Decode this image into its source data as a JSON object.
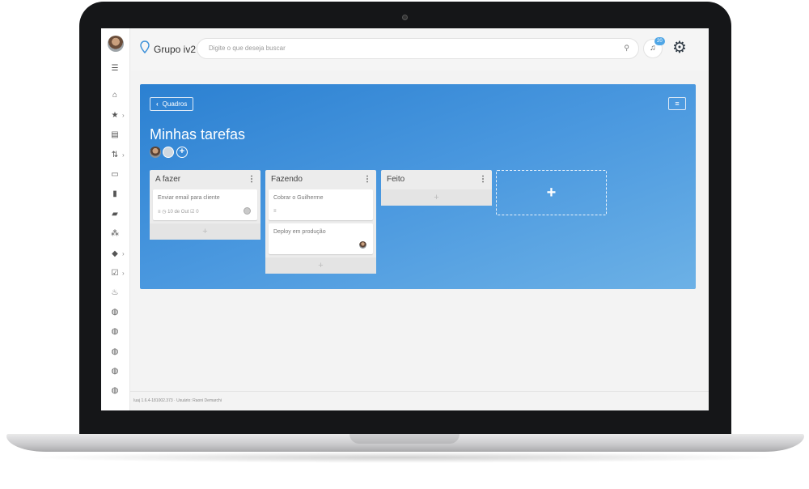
{
  "app": {
    "brand": "Grupo iv2"
  },
  "search": {
    "placeholder": "Digite o que deseja buscar"
  },
  "notifications": {
    "badge": "20"
  },
  "sidebar": {
    "icons": [
      "menu-icon",
      "home-icon",
      "star-icon",
      "book-icon",
      "swap-icon",
      "monitor-icon",
      "trash-icon",
      "chat-icon",
      "people-icon",
      "school-icon",
      "clipboard-check-icon",
      "fire-icon",
      "globe-icon",
      "globe-icon",
      "globe-icon",
      "globe-icon",
      "globe-icon"
    ]
  },
  "board": {
    "back_label": "Quadros",
    "title": "Minhas tarefas",
    "add_list_symbol": "+",
    "lists": [
      {
        "title": "A fazer",
        "cards": [
          {
            "title": "Enviar email para cliente",
            "meta_date": "10 de Out",
            "meta_checklist": "0"
          }
        ]
      },
      {
        "title": "Fazendo",
        "cards": [
          {
            "title": "Cobrar o Guilherme"
          },
          {
            "title": "Deploy em produção"
          }
        ]
      },
      {
        "title": "Feito",
        "cards": []
      }
    ],
    "add_card_symbol": "+"
  },
  "footer": {
    "text": "Iuaj 1.6.4-181002.373 · Usuário: Raoni Demarchi"
  },
  "colors": {
    "board_gradient_start": "#2b80d1",
    "board_gradient_end": "#6cb1e6",
    "badge": "#4fa6e6"
  }
}
